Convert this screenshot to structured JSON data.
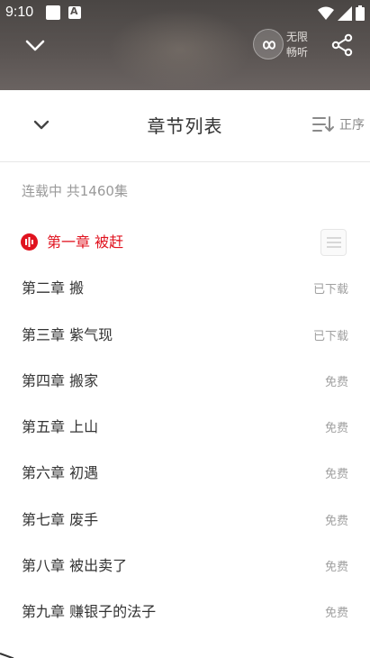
{
  "status_bar": {
    "time": "9:10"
  },
  "player": {
    "unlimited_label": "无限畅听"
  },
  "sheet": {
    "title": "章节列表",
    "sort_label": "正序",
    "summary": "连载中 共1460集"
  },
  "chapters": [
    {
      "title": "第一章 被赶",
      "status": "",
      "active": true
    },
    {
      "title": "第二章 搬",
      "status": "已下载"
    },
    {
      "title": "第三章 紫气现",
      "status": "已下载"
    },
    {
      "title": "第四章 搬家",
      "status": "免费"
    },
    {
      "title": "第五章 上山",
      "status": "免费"
    },
    {
      "title": "第六章 初遇",
      "status": "免费"
    },
    {
      "title": "第七章 废手",
      "status": "免费"
    },
    {
      "title": "第八章 被出卖了",
      "status": "免费"
    },
    {
      "title": "第九章 赚银子的法子",
      "status": "免费"
    }
  ],
  "colors": {
    "accent": "#e0131f",
    "text": "#333333",
    "muted": "#a0a0a0"
  }
}
